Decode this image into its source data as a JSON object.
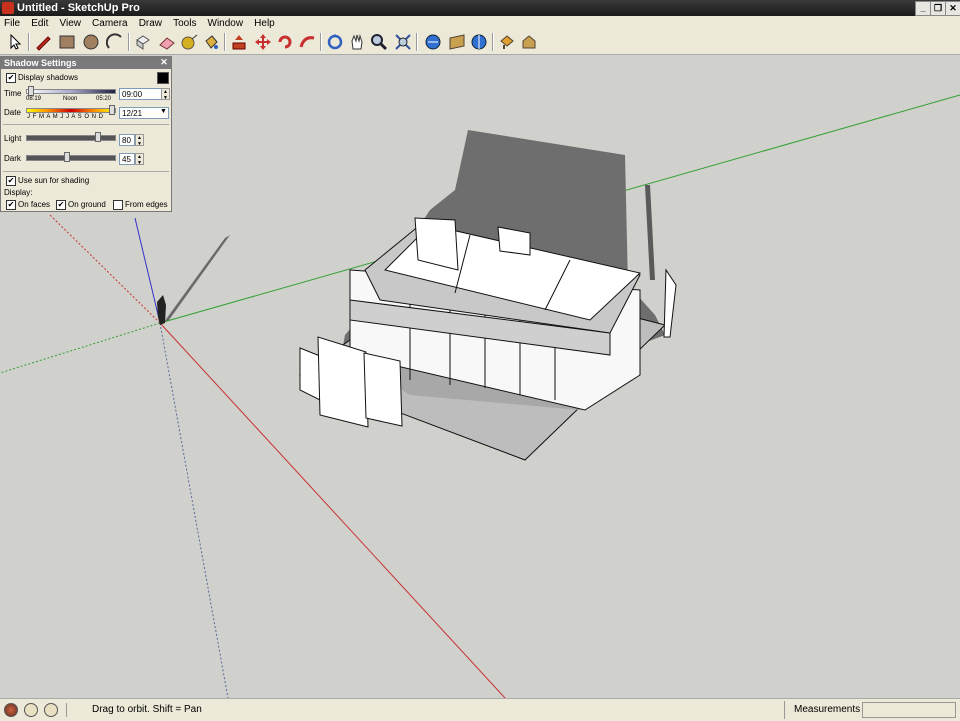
{
  "window": {
    "title": "Untitled - SketchUp Pro"
  },
  "menu": [
    "File",
    "Edit",
    "View",
    "Camera",
    "Draw",
    "Tools",
    "Window",
    "Help"
  ],
  "toolbar": [
    "select-icon",
    "pencil-icon",
    "rectangle-icon",
    "circle-icon",
    "arc-icon",
    "eraser-icon",
    "paint-bucket-icon",
    "push-pull-icon",
    "move-icon",
    "follow-me-icon",
    "rotate-icon",
    "offset-icon",
    "orbit-icon",
    "pan-icon",
    "zoom-icon",
    "zoom-extents-icon",
    "get-models-icon",
    "share-model-icon",
    "share-component-icon",
    "get-photo-texture-icon",
    "warehouse-icon"
  ],
  "shadow_settings": {
    "title": "Shadow Settings",
    "display_shadows": {
      "label": "Display shadows",
      "checked": true
    },
    "time": {
      "label": "Time",
      "sunrise": "08:19",
      "noon": "Noon",
      "sunset": "05:20",
      "value": "09:00"
    },
    "date": {
      "label": "Date",
      "months": "J F M A M J J A S O N D",
      "value": "12/21"
    },
    "light": {
      "label": "Light",
      "value": "80"
    },
    "dark": {
      "label": "Dark",
      "value": "45"
    },
    "use_sun": {
      "label": "Use sun for shading",
      "checked": true
    },
    "display_label": "Display:",
    "on_faces": {
      "label": "On faces",
      "checked": true
    },
    "on_ground": {
      "label": "On ground",
      "checked": true
    },
    "from_edges": {
      "label": "From edges",
      "checked": false
    }
  },
  "status": {
    "hint": "Drag to orbit.  Shift = Pan",
    "measurements_label": "Measurements",
    "measurements_value": ""
  },
  "colors": {
    "titlebar": "#2a2a2a",
    "viewport": "#d0d0cc",
    "red_axis": "#c83232",
    "green_axis": "#32a032",
    "blue_axis": "#3232c8"
  }
}
